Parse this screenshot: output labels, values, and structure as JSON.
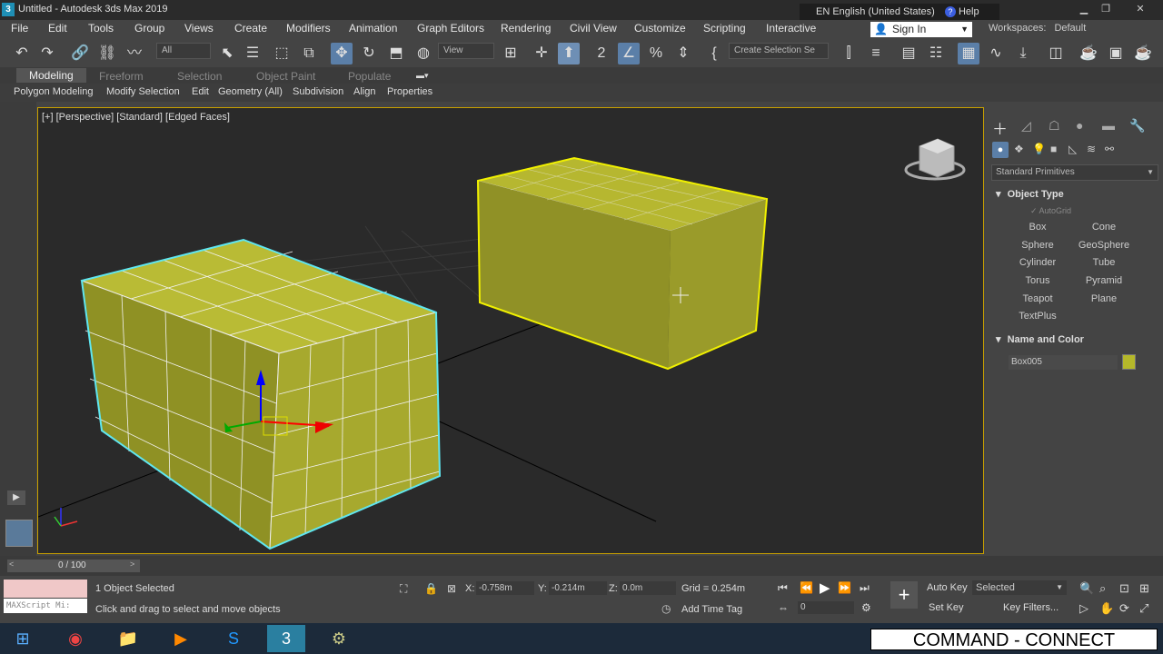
{
  "window": {
    "title": "Untitled - Autodesk 3ds Max 2019",
    "language": "EN English (United States)",
    "help": "Help"
  },
  "menubar": {
    "items": [
      "File",
      "Edit",
      "Tools",
      "Group",
      "Views",
      "Create",
      "Modifiers",
      "Animation",
      "Graph Editors",
      "Rendering",
      "Civil View",
      "Customize",
      "Scripting",
      "Interactive"
    ],
    "signin": "Sign In",
    "workspaces_label": "Workspaces:",
    "workspaces_value": "Default"
  },
  "toolbar": {
    "filter": "All",
    "refcoord": "View",
    "selection_set": "Create Selection Se",
    "snap_label": "2"
  },
  "ribbon": {
    "tabs": [
      "Modeling",
      "Freeform",
      "Selection",
      "Object Paint",
      "Populate"
    ],
    "active_tab": "Modeling",
    "panels": [
      "Polygon Modeling",
      "Modify Selection",
      "Edit",
      "Geometry (All)",
      "Subdivision",
      "Align",
      "Properties"
    ]
  },
  "viewport": {
    "label": "[+] [Perspective] [Standard] [Edged Faces]"
  },
  "command_panel": {
    "category": "Standard Primitives",
    "object_type_title": "Object Type",
    "autogrid": "AutoGrid",
    "buttons": [
      "Box",
      "Cone",
      "Sphere",
      "GeoSphere",
      "Cylinder",
      "Tube",
      "Torus",
      "Pyramid",
      "Teapot",
      "Plane",
      "TextPlus"
    ],
    "name_color_title": "Name and Color",
    "object_name": "Box005",
    "object_color": "#b5b82a"
  },
  "timeline": {
    "frame": "0 / 100"
  },
  "status": {
    "maxscript": "MAXScript Mi:",
    "selected": "1 Object Selected",
    "hint": "Click and drag to select and move objects",
    "x_label": "X:",
    "x": "-0.758m",
    "y_label": "Y:",
    "y": "-0.214m",
    "z_label": "Z:",
    "z": "0.0m",
    "grid": "Grid = 0.254m",
    "add_time_tag": "Add Time Tag",
    "auto_key": "Auto Key",
    "set_key": "Set Key",
    "key_mode": "Selected",
    "key_filters": "Key Filters...",
    "frame_field": "0"
  },
  "overlay": {
    "text": "COMMAND - CONNECT"
  }
}
